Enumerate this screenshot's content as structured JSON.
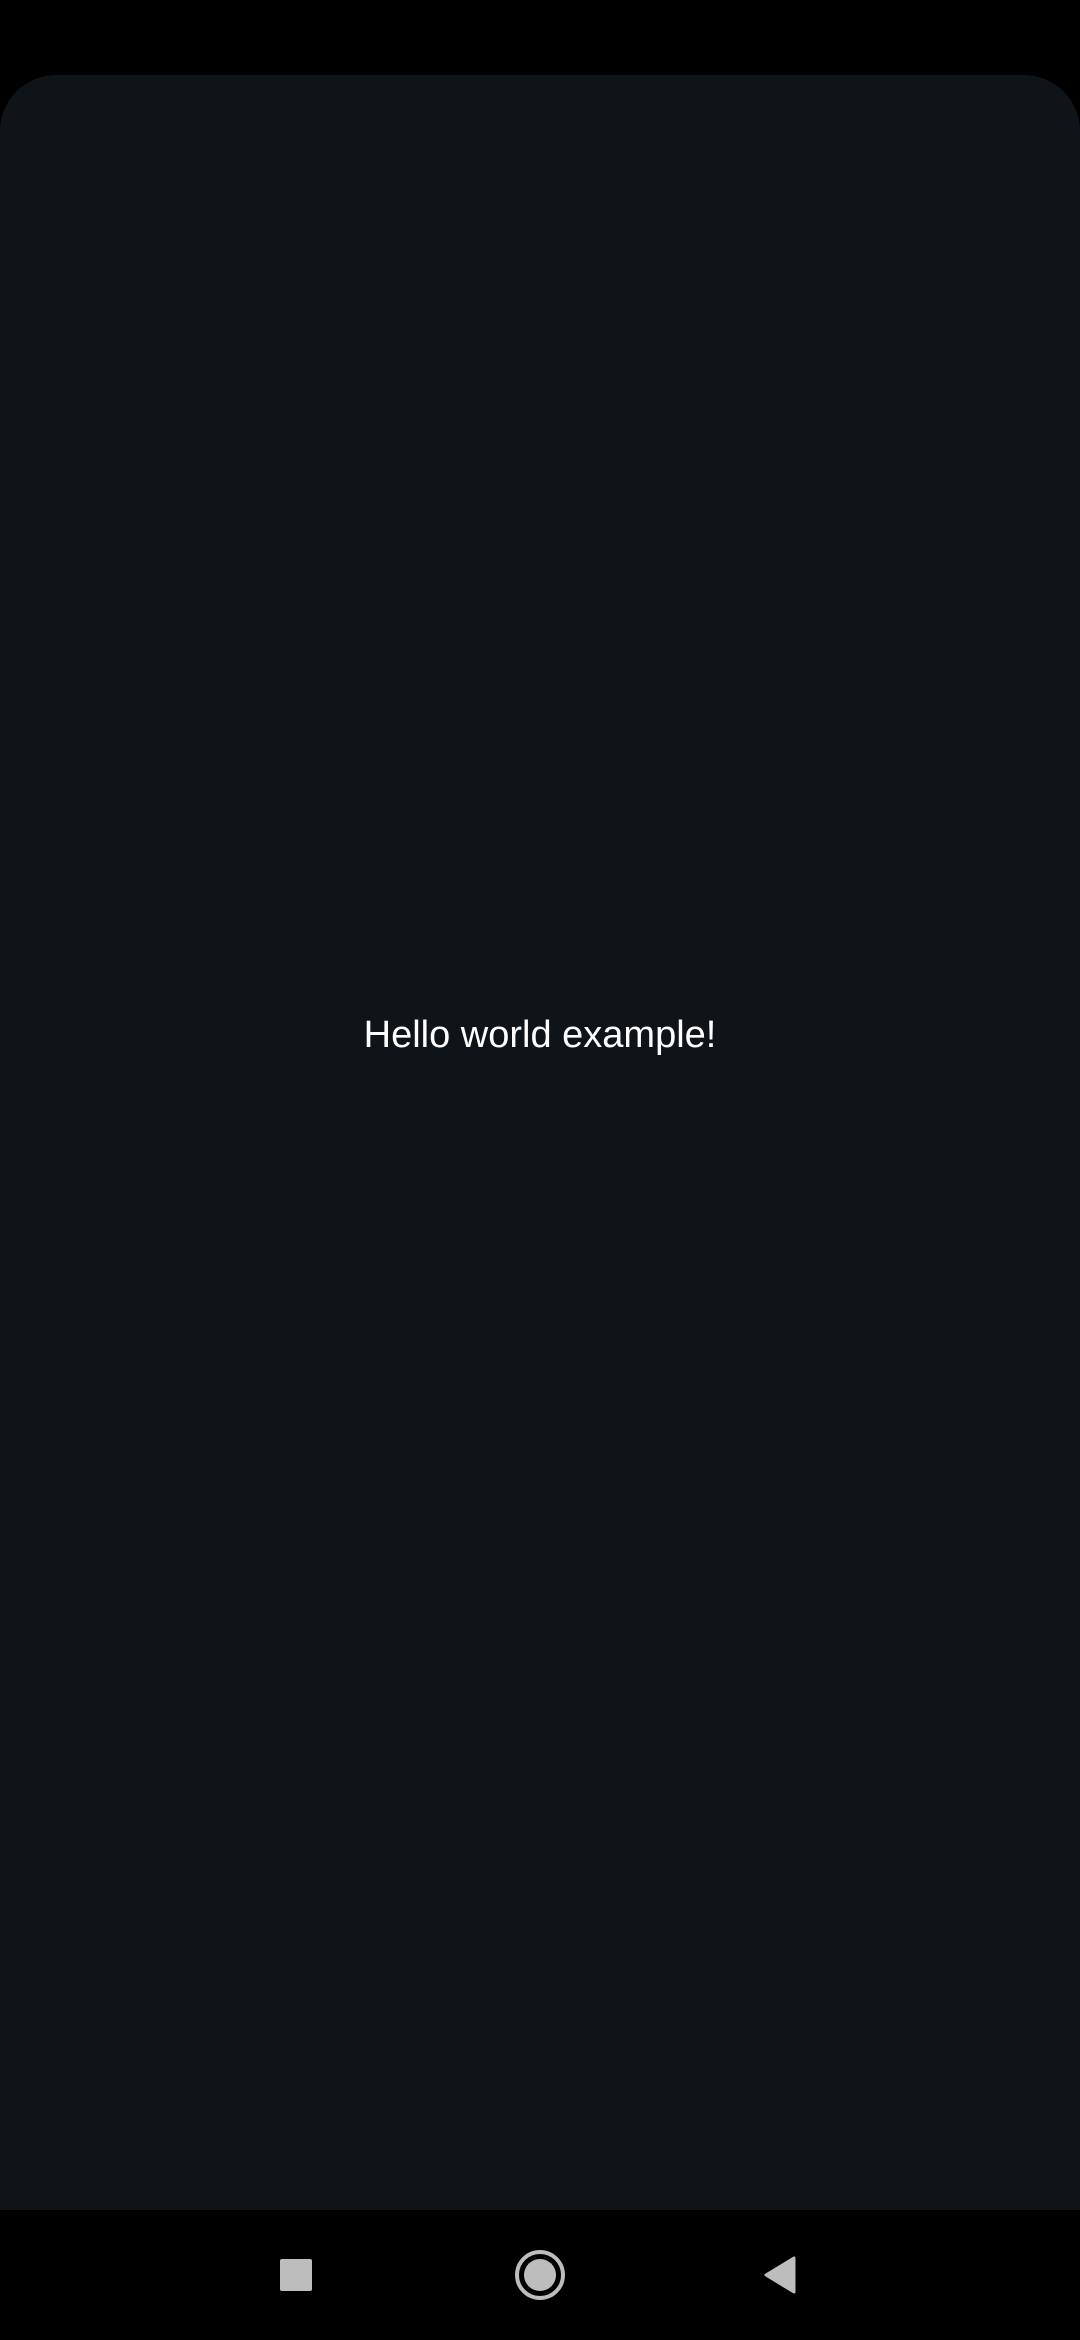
{
  "main": {
    "message": "Hello world example!"
  },
  "navigation_bar": {
    "buttons": [
      {
        "name": "recents",
        "icon": "square-icon"
      },
      {
        "name": "home",
        "icon": "circle-icon"
      },
      {
        "name": "back",
        "icon": "triangle-back-icon"
      }
    ]
  },
  "colors": {
    "background": "#0f1418",
    "system_bars": "#000000",
    "text": "#ffffff",
    "nav_icons": "#bdbdbd"
  }
}
